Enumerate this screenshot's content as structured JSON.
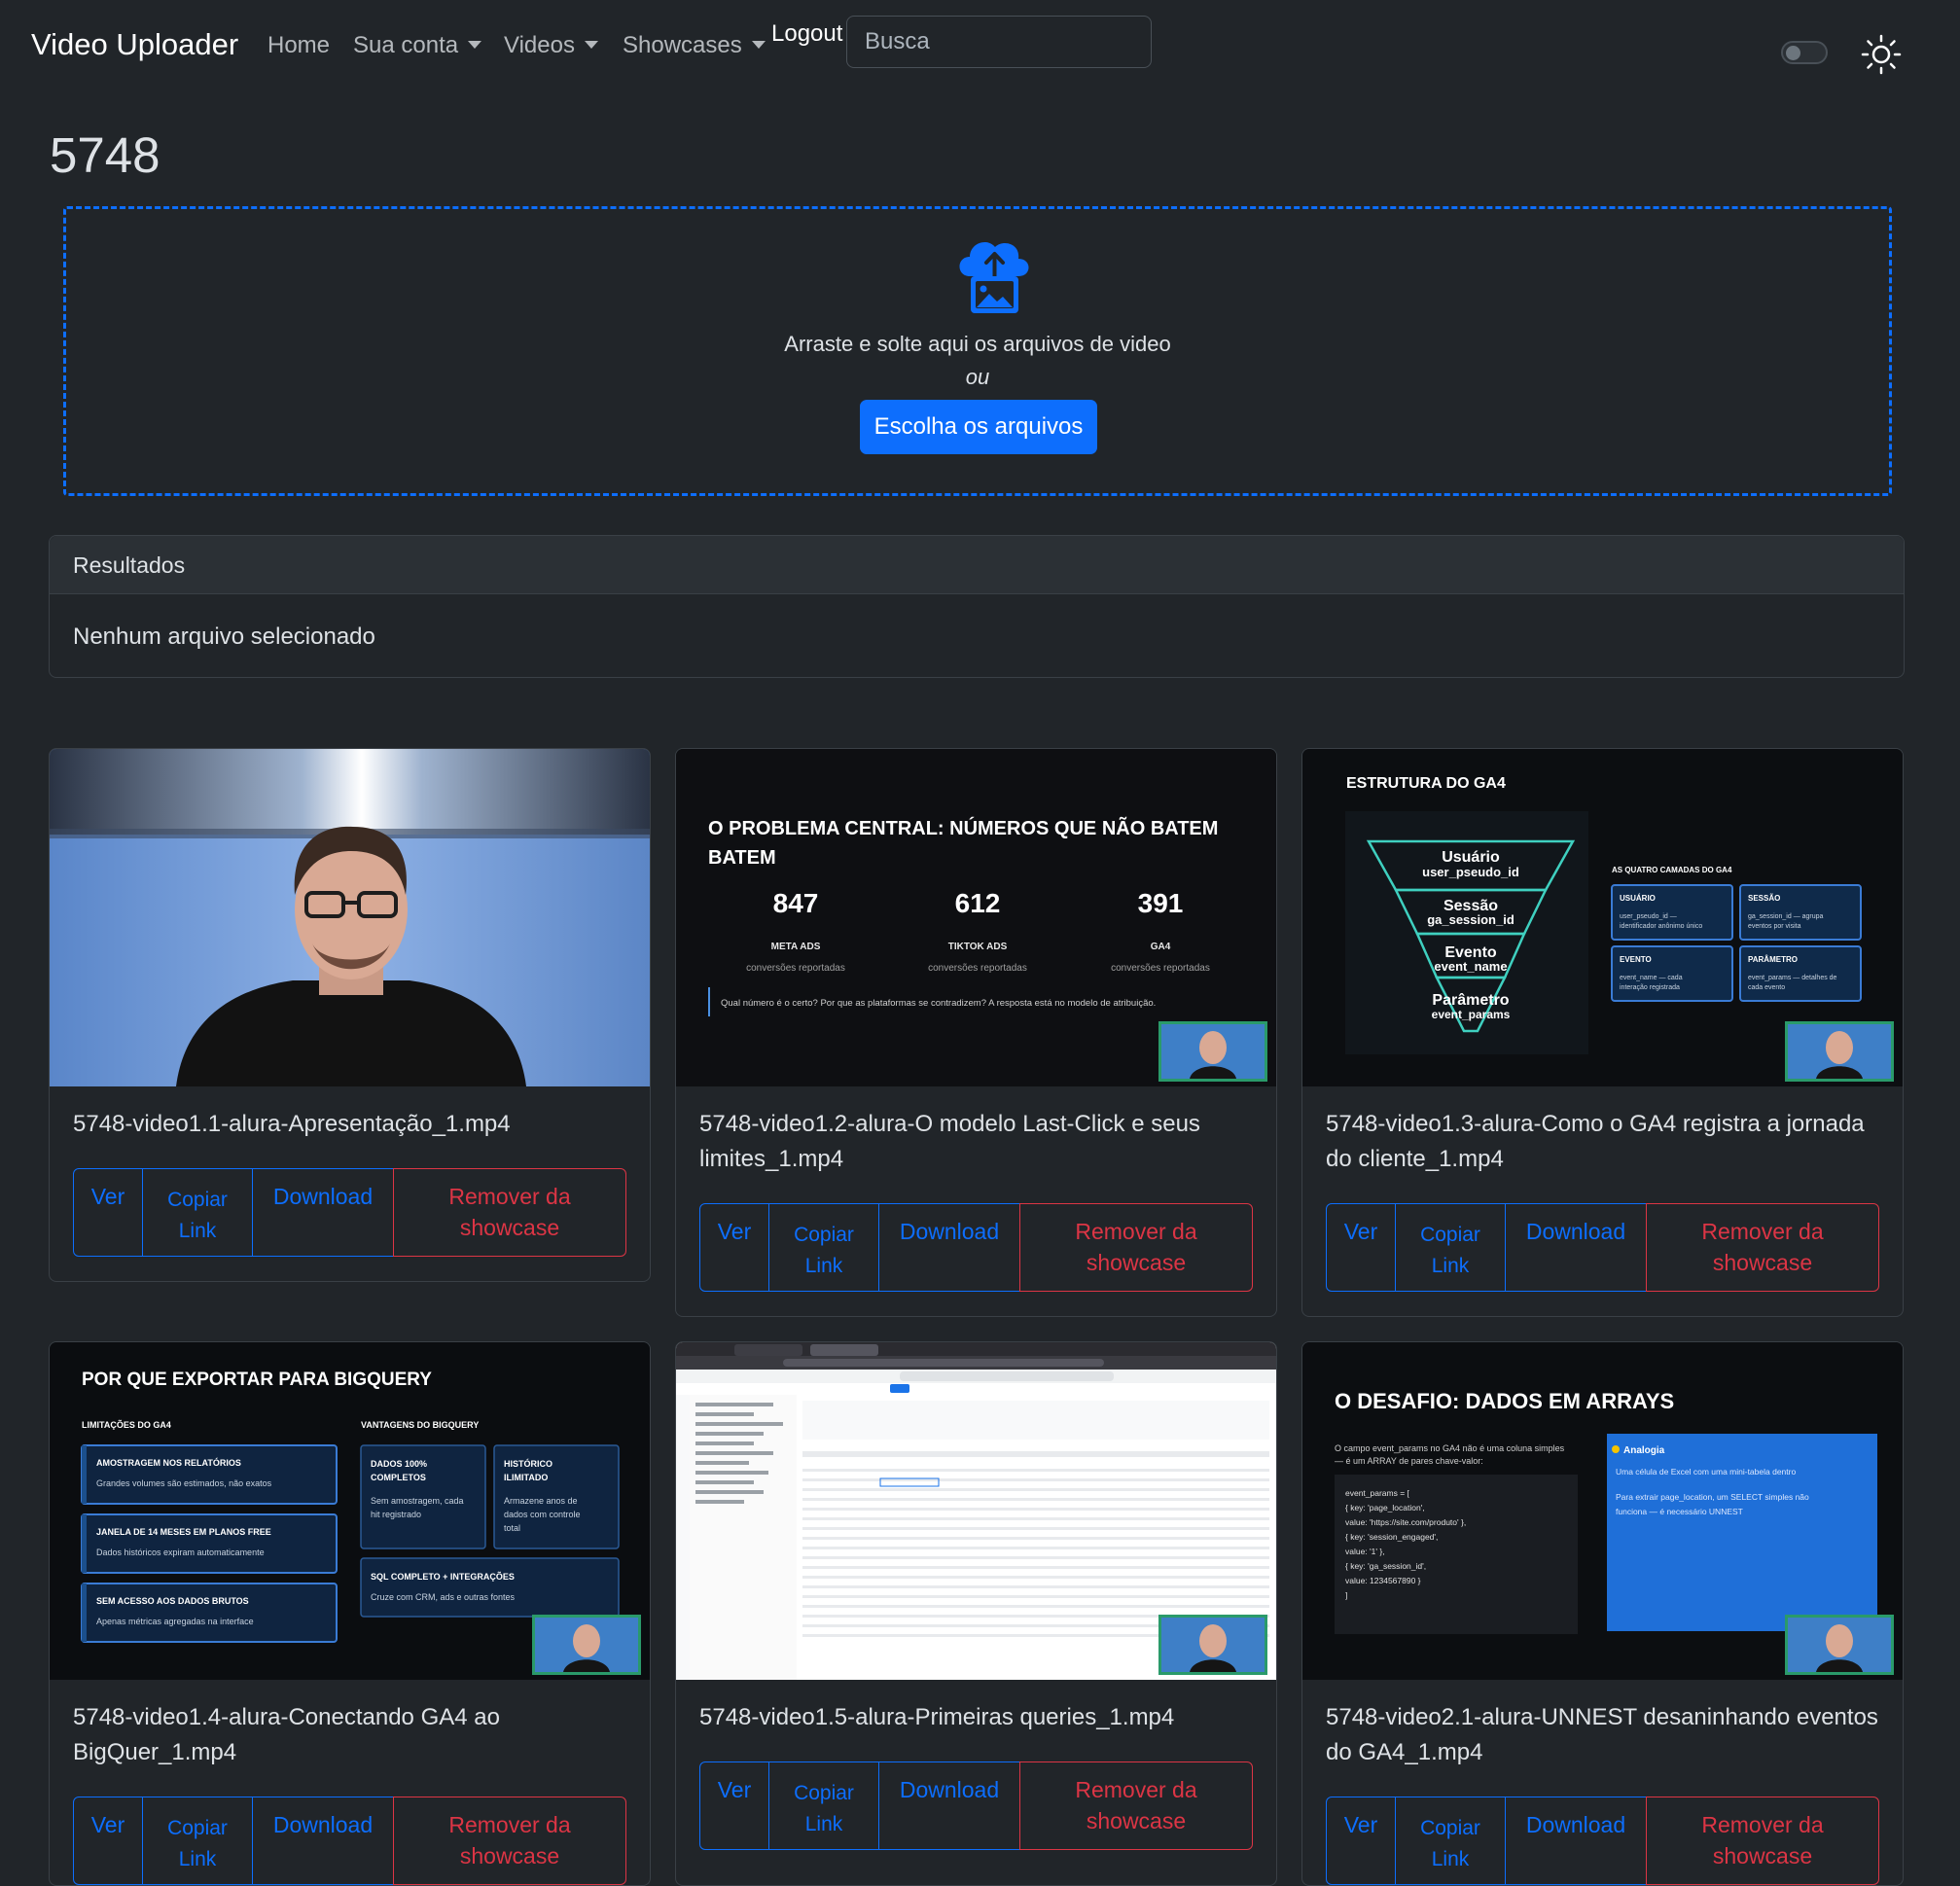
{
  "nav": {
    "brand": "Video Uploader",
    "home": "Home",
    "account": "Sua conta",
    "videos": "Videos",
    "showcases": "Showcases",
    "logout": "Logout",
    "search_placeholder": "Busca"
  },
  "page": {
    "title": "5748"
  },
  "dropzone": {
    "text": "Arraste e solte aqui os arquivos de video",
    "or": "ou",
    "button": "Escolha os arquivos"
  },
  "results": {
    "header": "Resultados",
    "body": "Nenhum arquivo selecionado"
  },
  "card_buttons": {
    "view": "Ver",
    "copy_1": "Copiar",
    "copy_2": "Link",
    "download": "Download",
    "remove_1": "Remover da",
    "remove_2": "showcase"
  },
  "videos": [
    {
      "filename": "5748-video1.1-alura-Apresentação_1.mp4"
    },
    {
      "filename": "5748-video1.2-alura-O modelo Last-Click e seus limites_1.mp4",
      "slide": {
        "title_1": "O PROBLEMA CENTRAL: NÚMEROS QUE NÃO BATEM",
        "title_2": "BATEM",
        "stats": [
          {
            "value": "847",
            "label": "META ADS",
            "sub": "conversões reportadas"
          },
          {
            "value": "612",
            "label": "TIKTOK ADS",
            "sub": "conversões reportadas"
          },
          {
            "value": "391",
            "label": "GA4",
            "sub": "conversões reportadas"
          }
        ],
        "note": "Qual número é o certo? Por que as plataformas se contradizem? A resposta está no modelo de atribuição."
      }
    },
    {
      "filename": "5748-video1.3-alura-Como o GA4 registra a jornada do cliente_1.mp4",
      "slide": {
        "title": "ESTRUTURA DO GA4",
        "funnel": [
          {
            "name": "Usuário",
            "id": "user_pseudo_id"
          },
          {
            "name": "Sessão",
            "id": "ga_session_id"
          },
          {
            "name": "Evento",
            "id": "event_name"
          },
          {
            "name": "Parâmetro",
            "id": "event_params"
          }
        ],
        "side_title": "AS QUATRO CAMADAS DO GA4",
        "boxes": [
          {
            "title": "USUÁRIO",
            "text_1": "user_pseudo_id —",
            "text_2": "identificador anônimo único"
          },
          {
            "title": "SESSÃO",
            "text_1": "ga_session_id — agrupa",
            "text_2": "eventos por visita"
          },
          {
            "title": "EVENTO",
            "text_1": "event_name — cada",
            "text_2": "interação registrada"
          },
          {
            "title": "PARÂMETRO",
            "text_1": "event_params — detalhes de",
            "text_2": "cada evento"
          }
        ]
      }
    },
    {
      "filename": "5748-video1.4-alura-Conectando GA4 ao BigQuer_1.mp4",
      "slide": {
        "title": "POR QUE EXPORTAR PARA BIGQUERY",
        "left_title": "LIMITAÇÕES DO GA4",
        "right_title": "VANTAGENS DO BIGQUERY",
        "limits": [
          {
            "title": "AMOSTRAGEM NOS RELATÓRIOS",
            "text": "Grandes volumes são estimados, não exatos"
          },
          {
            "title": "JANELA DE 14 MESES EM PLANOS FREE",
            "text": "Dados históricos expiram automaticamente"
          },
          {
            "title": "SEM ACESSO AOS DADOS BRUTOS",
            "text": "Apenas métricas agregadas na interface"
          }
        ],
        "adv": [
          {
            "title_1": "DADOS 100%",
            "title_2": "COMPLETOS",
            "text_1": "Sem amostragem, cada",
            "text_2": "hit registrado"
          },
          {
            "title_1": "HISTÓRICO",
            "title_2": "ILIMITADO",
            "text_1": "Armazene anos de",
            "text_2": "dados com controle",
            "text_3": "total"
          }
        ],
        "sql_title": "SQL COMPLETO + INTEGRAÇÕES",
        "sql_text": "Cruze com CRM, ads e outras fontes"
      }
    },
    {
      "filename": "5748-video1.5-alura-Primeiras queries_1.mp4"
    },
    {
      "filename": "5748-video2.1-alura-UNNEST desaninhando eventos do GA4_1.mp4",
      "slide": {
        "title": "O DESAFIO: DADOS EM ARRAYS",
        "intro_1": "O campo event_params no GA4 não é uma coluna simples",
        "intro_2": "— é um ARRAY de pares chave-valor:",
        "code": [
          "event_params = [",
          "  { key: 'page_location',",
          "    value: 'https://site.com/produto' },",
          "  { key: 'session_engaged',",
          "    value: '1' },",
          "  { key: 'ga_session_id',",
          "    value: 1234567890 }",
          "]"
        ],
        "analogy_title": "Analogia",
        "analogy_1": "Uma célula de Excel com uma mini-tabela dentro",
        "analogy_2": "Para extrair page_location, um SELECT simples não",
        "analogy_3": "funciona — é necessário UNNEST"
      }
    }
  ],
  "colors": {
    "background": "#212529",
    "primary": "#0d6efd",
    "danger": "#dc3545"
  },
  "icons": {
    "theme": "sun-icon",
    "upload": "cloud-upload-image-icon",
    "dropdown": "caret-down-icon"
  }
}
